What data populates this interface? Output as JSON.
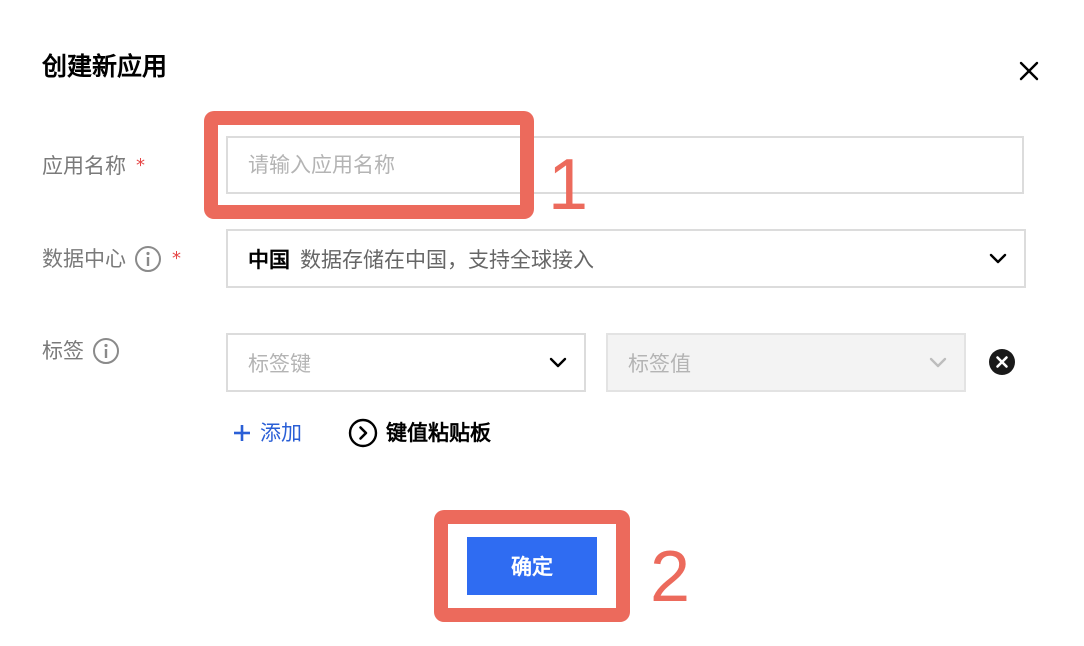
{
  "dialog": {
    "title": "创建新应用",
    "close_icon": "close-icon"
  },
  "form": {
    "app_name": {
      "label": "应用名称",
      "required_mark": "*",
      "placeholder": "请输入应用名称",
      "value": ""
    },
    "datacenter": {
      "label": "数据中心",
      "required_mark": "*",
      "info_icon": "info-icon",
      "selected_main": "中国",
      "selected_desc": "数据存储在中国，支持全球接入",
      "chevron_icon": "chevron-down-icon"
    },
    "tags": {
      "label": "标签",
      "info_icon": "info-icon",
      "key_placeholder": "标签键",
      "value_placeholder": "标签值",
      "remove_icon": "close-circle-icon"
    },
    "add_label": "添加",
    "clipboard_label": "键值粘贴板"
  },
  "footer": {
    "confirm_label": "确定"
  },
  "annotations": {
    "step1": "1",
    "step2": "2",
    "highlight_color": "#ec6a5c"
  },
  "colors": {
    "primary": "#2f6cf2",
    "link": "#2a5fd6",
    "required": "#e54545",
    "border": "#dcdcdc",
    "label": "#7a7a7a"
  }
}
